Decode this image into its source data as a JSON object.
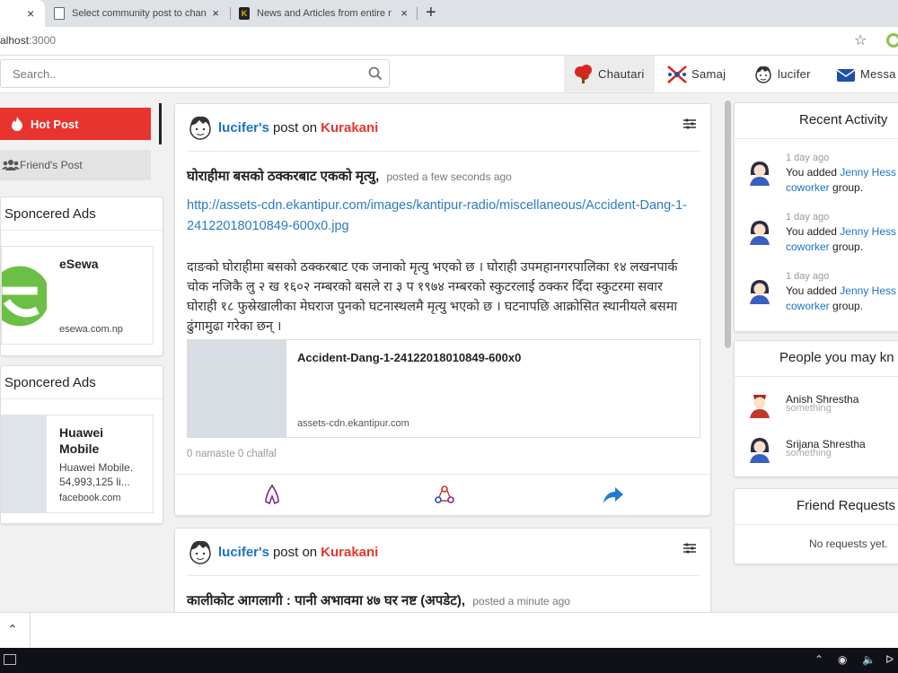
{
  "browser": {
    "tabs": [
      {
        "title": "",
        "active": true
      },
      {
        "title": "Select community post to change"
      },
      {
        "title": "News and Articles from entire ne"
      }
    ],
    "close_glyph": "×",
    "new_tab": "+",
    "url_host": "alhost",
    "url_port": ":3000"
  },
  "navbar": {
    "search_placeholder": "Search..",
    "items": [
      {
        "label": "Chautari",
        "active": true
      },
      {
        "label": "Samaj"
      },
      {
        "label": "lucifer"
      },
      {
        "label": "Messa"
      }
    ]
  },
  "sidebar": {
    "hot_post": "Hot Post",
    "friends_post": "Friend's Post"
  },
  "ads": [
    {
      "header": "Sponcered Ads",
      "name": "eSewa",
      "description": "",
      "domain": "esewa.com.np"
    },
    {
      "header": "Sponcered Ads",
      "name": "Huawei Mobile",
      "description": "Huawei Mobile. 54,993,125 li...",
      "domain": "facebook.com"
    }
  ],
  "posts": [
    {
      "author": "lucifer's",
      "post_on": "post on",
      "group": "Kurakani",
      "title": "घोराहीमा बसको ठक्करबाट एकको मृत्यु",
      "time": "posted a few seconds ago",
      "link": "http://assets-cdn.ekantipur.com/images/kantipur-radio/miscellaneous/Accident-Dang-1-24122018010849-600x0.jpg",
      "body": "दाङको घोराहीमा बसको ठक्करबाट एक जनाको मृत्यु भएको छ । घोराही उपमहानगरपालिका १४ लखनपार्क चोक नजिकै लु २ ख १६०२ नम्बरको बसले रा ३ प १९७४ नम्बरको स्कुटरलाई ठक्कर दिँदा स्कुटरमा सवार घोराही १८ फुस्रेखालीका मेघराज पुनको घटनास्थलमै मृत्यु भएको छ । घटनापछि आक्रोसित स्थानीयले बसमा ढुंगामुढा गरेका छन् ।",
      "preview_title": "Accident-Dang-1-24122018010849-600x0",
      "preview_domain": "assets-cdn.ekantipur.com",
      "stats": "0 namaste  0 chalfal"
    },
    {
      "author": "lucifer's",
      "post_on": "post on",
      "group": "Kurakani",
      "title": "कालीकोट आगलागी : पानी अभावमा ४७ घर नष्ट (अपडेट)",
      "time": "posted a minute ago"
    }
  ],
  "recent_activity": {
    "title": "Recent Activity",
    "items": [
      {
        "time": "1 day ago",
        "prefix": "You added",
        "person": "Jenny Hess",
        "suffix": "t",
        "group": "coworker",
        "group_suffix": "group."
      },
      {
        "time": "1 day ago",
        "prefix": "You added",
        "person": "Jenny Hess",
        "suffix": "t",
        "group": "coworker",
        "group_suffix": "group."
      },
      {
        "time": "1 day ago",
        "prefix": "You added",
        "person": "Jenny Hess",
        "suffix": "t",
        "group": "coworker",
        "group_suffix": "group."
      }
    ]
  },
  "people": {
    "title": "People you may kn",
    "items": [
      {
        "name": "Anish Shrestha",
        "sub": "something"
      },
      {
        "name": "Srijana Shrestha",
        "sub": "something"
      }
    ]
  },
  "friend_requests": {
    "title": "Friend Requests",
    "empty": "No requests yet."
  },
  "colors": {
    "accent_red": "#e8342f",
    "link_blue": "#1a73c7"
  }
}
